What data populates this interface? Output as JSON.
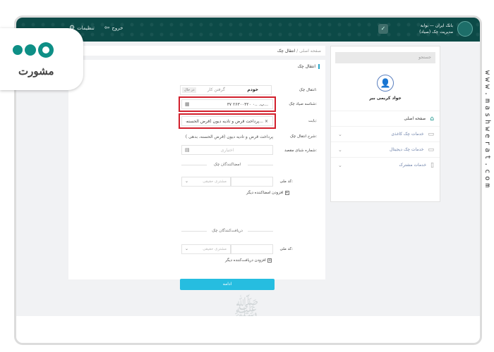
{
  "watermark": {
    "site": "www.mashwerat.com"
  },
  "badge": {
    "name": "مشورت"
  },
  "topbar": {
    "brand_line1": "بانک ایران — بوابة",
    "brand_line2": "مدیریت چک (صیاد)",
    "settings_label": "تنظیمات",
    "exit_label": "خروج"
  },
  "sidebar": {
    "search_placeholder": "جستجو",
    "user_name": "جواد کریمی بیر",
    "items": [
      {
        "label": "صفحه اصلی"
      },
      {
        "label": "خدمات چک کاغذی"
      },
      {
        "label": "خدمات چک دیجیتال"
      },
      {
        "label": "خدمات مشترک"
      }
    ]
  },
  "breadcrumb": {
    "home": "صفحه اصلی",
    "sep": "/",
    "current": "انتقال چک"
  },
  "form": {
    "title": "انتقال چک",
    "transfer_label": "انتقال چک:",
    "toggle_self": "خودم",
    "toggle_other": "گرفتن کار",
    "toggle_tag": "در حال",
    "sayad_label": "شناسه صیاد چک:",
    "sayad_value": "۳۷ ب. ..۰ ۲۶۳۰۰۳۲۰...",
    "reason_label": "بابت:",
    "reason_value": "پرداخت قرض و تادیه دیون (قرض الحسنه... ×",
    "desc_label": "شرح انتقال چک:",
    "desc_value": "پرداخت قرض و تادیه دیون (قرض الحسنه، بدهی )",
    "national_label": "شماره شبای مقصد:",
    "national_placeholder": "اختیاری",
    "signers_title": "امضاکنندگان چک",
    "signer_code_label": "کد ملی:",
    "signer_select": "مشتری حقیقی",
    "signer_add": "افزودن امضاکننده دیگر",
    "receivers_title": "دریافت‌کنندگان چک",
    "receiver_code_label": "کد ملی:",
    "receiver_select": "مشتری حقیقی",
    "receiver_add": "افزودن دریافت‌کننده دیگر",
    "submit_label": "ادامه"
  },
  "colors": {
    "header": "#0c4a47",
    "accent": "#26bde0",
    "highlight": "#d21f2c",
    "brand": "#0e8f86"
  }
}
